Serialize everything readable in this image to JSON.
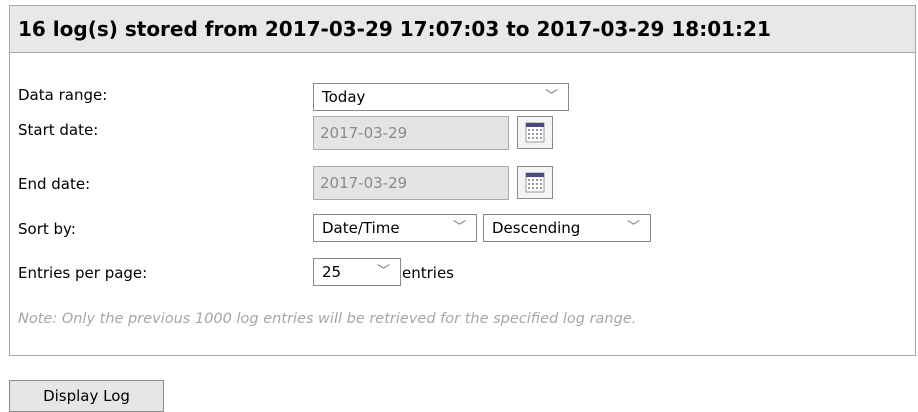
{
  "header": {
    "title": "16 log(s) stored from 2017-03-29 17:07:03 to 2017-03-29 18:01:21"
  },
  "form": {
    "data_range": {
      "label": "Data range:",
      "value": "Today"
    },
    "start_date": {
      "label": "Start date:",
      "value": "2017-03-29"
    },
    "end_date": {
      "label": "End date:",
      "value": "2017-03-29"
    },
    "sort_by": {
      "label": "Sort by:",
      "field": "Date/Time",
      "order": "Descending"
    },
    "entries_per_page": {
      "label": "Entries per page:",
      "value": "25",
      "suffix": "entries"
    },
    "note": "Note: Only the previous 1000 log entries will be retrieved for the specified log range."
  },
  "actions": {
    "display_log": "Display Log"
  },
  "icons": {
    "chevron": "chevron-down-icon",
    "calendar": "calendar-icon"
  }
}
